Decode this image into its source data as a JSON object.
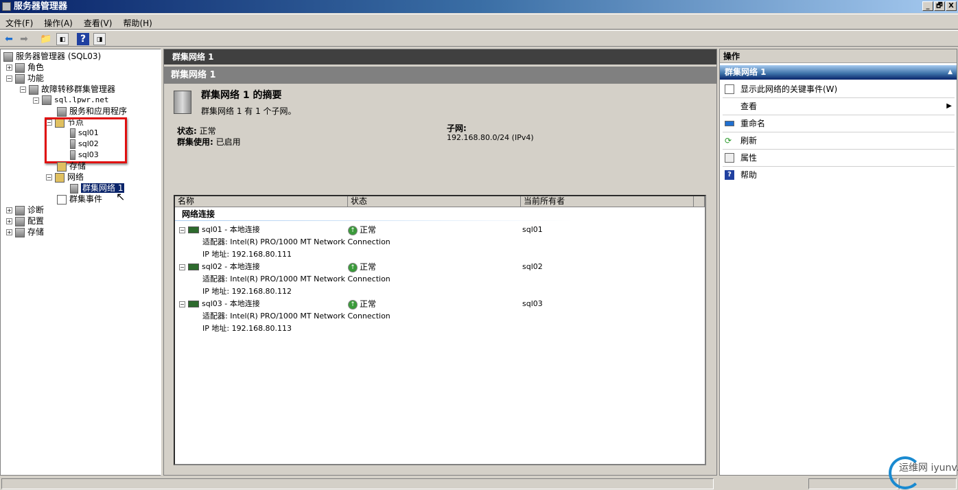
{
  "window": {
    "title": "服务器管理器",
    "min": "_",
    "max": "🗗",
    "close": "X"
  },
  "menu": [
    "文件(F)",
    "操作(A)",
    "查看(V)",
    "帮助(H)"
  ],
  "tree": {
    "root": "服务器管理器 (SQL03)",
    "roles": "角色",
    "features": "功能",
    "fcm": "故障转移群集管理器",
    "cluster": "sql.lpwr.net",
    "services": "服务和应用程序",
    "nodes": "节点",
    "node1": "sql01",
    "node2": "sql02",
    "node3": "sql03",
    "storage": "存储",
    "networks": "网络",
    "network1": "群集网络 1",
    "events": "群集事件",
    "diagnostics": "诊断",
    "config": "配置",
    "storage2": "存储"
  },
  "main": {
    "header": "群集网络 1",
    "subheader": "群集网络 1",
    "summary_title": "群集网络 1 的摘要",
    "summary_desc": "群集网络 1 有 1 个子网。",
    "status_label": "状态:",
    "status_value": "正常",
    "usage_label": "群集使用:",
    "usage_value": "已启用",
    "subnet_label": "子网:",
    "subnet_value": "192.168.80.0/24 (IPv4)",
    "columns": [
      "名称",
      "状态",
      "当前所有者"
    ],
    "group": "网络连接",
    "connections": [
      {
        "name": "sql01 - 本地连接",
        "status": "正常",
        "owner": "sql01",
        "adapter": "适配器: Intel(R) PRO/1000 MT Network Connection",
        "ip": "IP 地址: 192.168.80.111"
      },
      {
        "name": "sql02 - 本地连接",
        "status": "正常",
        "owner": "sql02",
        "adapter": "适配器: Intel(R) PRO/1000 MT Network Connection",
        "ip": "IP 地址: 192.168.80.112"
      },
      {
        "name": "sql03 - 本地连接",
        "status": "正常",
        "owner": "sql03",
        "adapter": "适配器: Intel(R) PRO/1000 MT Network Connection",
        "ip": "IP 地址: 192.168.80.113"
      }
    ]
  },
  "actions": {
    "header": "操作",
    "section": "群集网络 1",
    "items": [
      "显示此网络的关键事件(W)",
      "查看",
      "重命名",
      "刷新",
      "属性",
      "帮助"
    ]
  },
  "watermark": "运维网 iyunv.com"
}
